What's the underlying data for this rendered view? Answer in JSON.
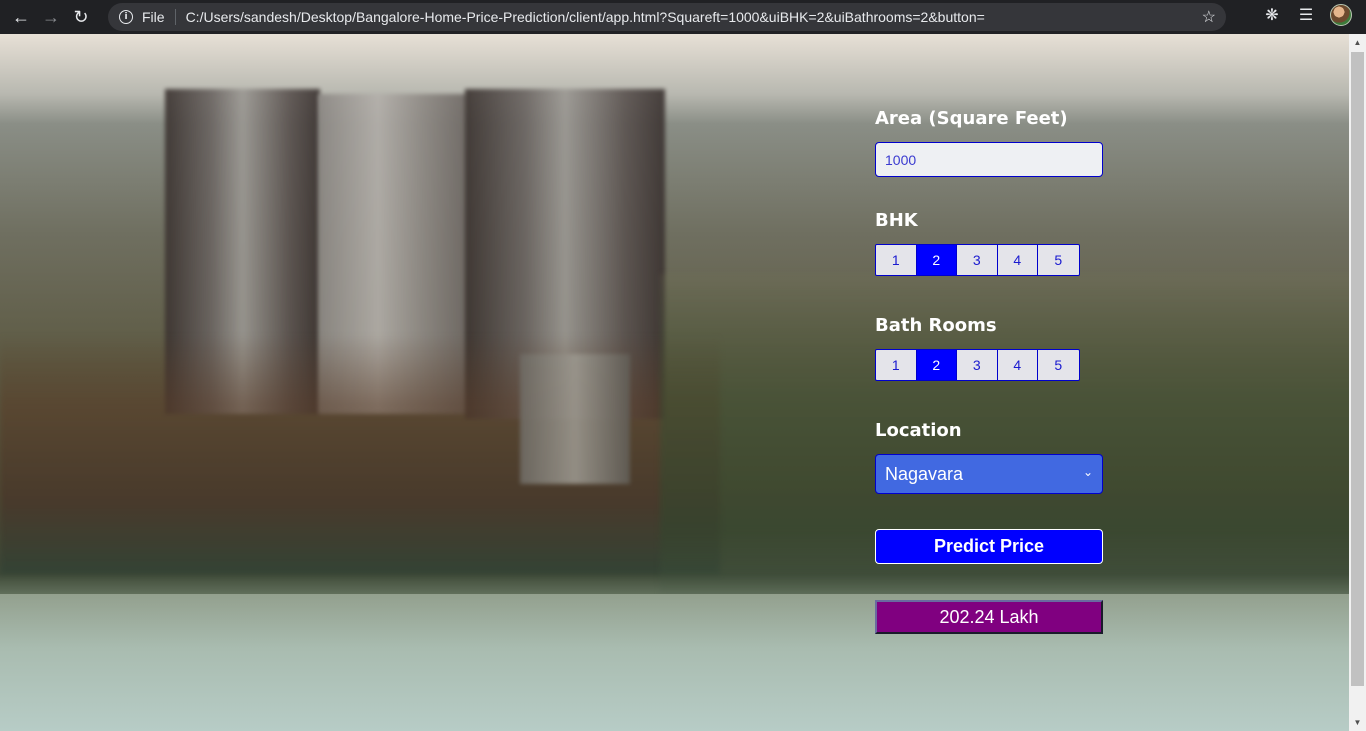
{
  "browser": {
    "scheme_label": "File",
    "url": "C:/Users/sandesh/Desktop/Bangalore-Home-Price-Prediction/client/app.html?Squareft=1000&uiBHK=2&uiBathrooms=2&button="
  },
  "form": {
    "area_label": "Area (Square Feet)",
    "area_value": "1000",
    "bhk_label": "BHK",
    "bhk_options": [
      "1",
      "2",
      "3",
      "4",
      "5"
    ],
    "bhk_selected": "2",
    "bath_label": "Bath Rooms",
    "bath_options": [
      "1",
      "2",
      "3",
      "4",
      "5"
    ],
    "bath_selected": "2",
    "location_label": "Location",
    "location_value": "Nagavara",
    "predict_label": "Predict Price",
    "result": "202.24 Lakh"
  },
  "colors": {
    "accent": "#0000ff",
    "select_bg": "#4169e1",
    "result_bg": "#800080"
  }
}
